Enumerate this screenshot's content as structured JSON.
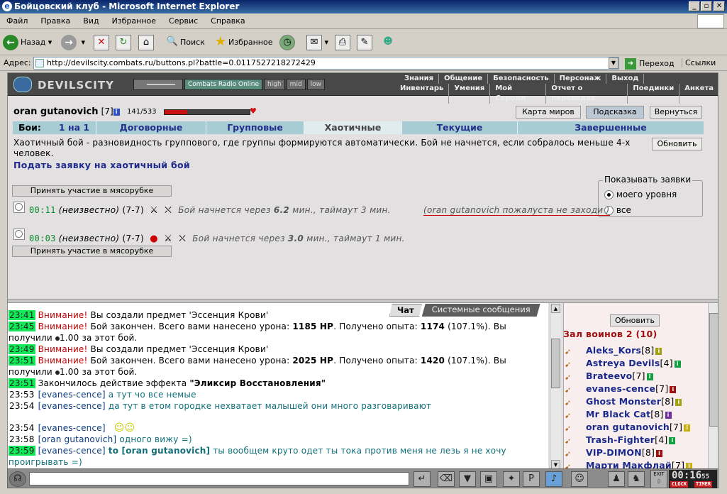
{
  "window": {
    "title": "Бойцовский клуб - Microsoft Internet Explorer"
  },
  "menu": [
    "Файл",
    "Правка",
    "Вид",
    "Избранное",
    "Сервис",
    "Справка"
  ],
  "toolbar": {
    "back": "Назад",
    "search": "Поиск",
    "favorites": "Избранное"
  },
  "address": {
    "label": "Адрес:",
    "url": "http://devilscity.combats.ru/buttons.pl?battle=0.0117527218272429",
    "go": "Переход",
    "links": "Ссылки"
  },
  "game": {
    "logo": "DEVILSCITY",
    "radio": {
      "name": "Combats Radio Online",
      "high": "high",
      "mid": "mid",
      "low": "low"
    },
    "nav_top": [
      "Знания",
      "Общение",
      "Безопасность",
      "Персонаж",
      "Выход"
    ],
    "nav_bottom": [
      "Инвентарь",
      "Умения",
      "Мой Скролл",
      "Отчет о переводах",
      "Поединки",
      "Анкета"
    ]
  },
  "user": {
    "name": "oran gutanovich",
    "level": "[7]",
    "hp": "141/533",
    "hp_fraction": 0.27
  },
  "top_buttons": {
    "map": "Карта миров",
    "hint": "Подсказка",
    "back": "Вернуться"
  },
  "fight_tabs": {
    "label": "Бои:",
    "items": [
      "1 на 1",
      "Договорные",
      "Групповые",
      "Хаотичные",
      "Текущие",
      "Завершенные"
    ]
  },
  "description": "Хаотичный бой - разновидность группового, где группы формируются автоматически. Бой не начнется, если собралось меньше 4-х человек.",
  "refresh": "Обновить",
  "apply_link": "Подать заявку на хаотичный бой",
  "filter": {
    "legend": "Показывать заявки",
    "opt1": "моего уровня",
    "opt2": "все"
  },
  "join_label": "Принять участие в мясорубке",
  "battles": [
    {
      "time": "00:11",
      "who": "(неизвестно)",
      "range": "(7-7)",
      "text_a": "Бой начнется через",
      "mins": "6.2",
      "text_b": "мин., таймаут 3 мин.",
      "comment": "(oran gutanovich пожалуста не заходи )"
    },
    {
      "time": "00:03",
      "who": "(неизвестно)",
      "range": "(7-7)",
      "text_a": "Бой начнется через",
      "mins": "3.0",
      "text_b": "мин., таймаут 1 мин."
    }
  ],
  "chat": {
    "tabs": [
      "Чат",
      "Системные сообщения"
    ],
    "lines": [
      {
        "t": "23:41",
        "w": "Внимание!",
        "m": "Вы создали предмет 'Эссенция Крови'"
      },
      {
        "t": "23:45",
        "w": "Внимание!",
        "m1": "Бой закончен. Всего вами нанесено урона:",
        "b1": "1185 HP",
        "m2": ". Получено опыта:",
        "b2": "1174",
        "m3": "(107.1%). Вы получили",
        "m4": "1.00 за этот бой."
      },
      {
        "t": "23:49",
        "w": "Внимание!",
        "m": "Вы создали предмет 'Эссенция Крови'"
      },
      {
        "t": "23:51",
        "w": "Внимание!",
        "m1": "Бой закончен. Всего вами нанесено урона:",
        "b1": "2025 HP",
        "m2": ". Получено опыта:",
        "b2": "1420",
        "m3": "(107.1%). Вы получили",
        "m4": "1.00 за этот бой."
      },
      {
        "t": "23:51",
        "w": "Закончилось действие эффекта",
        "b": "\"Эликсир Восстановления\""
      },
      {
        "t": "23:53",
        "n": "[evanes-cence]",
        "m": "а тут чо все немые"
      },
      {
        "t": "23:54",
        "n": "[evanes-cence]",
        "m": "да тут в етом городке нехватает малышей они много разговаривают"
      },
      {
        "t": "23:54",
        "n": "[evanes-cence]"
      },
      {
        "t": "23:58",
        "n": "[oran gutanovich]",
        "m": "одного вижу =)"
      },
      {
        "t": "23:59",
        "n": "[evanes-cence]",
        "to": "to [oran gutanovich]",
        "m": "ты вообщем круто одет ты тока против меня не лезь я не хочу проигрывать =)"
      }
    ]
  },
  "room": {
    "refresh": "Обновить",
    "name": "Зал воинов 2 (10)",
    "users": [
      {
        "name": "Aleks_Kors",
        "lvl": "[8]",
        "color": "#a0a010"
      },
      {
        "name": "Astreya Devils",
        "lvl": "[4]",
        "color": "#10a040"
      },
      {
        "name": "Brateevo",
        "lvl": "[7]",
        "color": "#10a040"
      },
      {
        "name": "evanes-cence",
        "lvl": "[7]",
        "color": "#a01010"
      },
      {
        "name": "Ghost Monster",
        "lvl": "[8]",
        "color": "#a0a010"
      },
      {
        "name": "Mr Black Cat",
        "lvl": "[8]",
        "color": "#7030a0"
      },
      {
        "name": "oran gutanovich",
        "lvl": "[7]",
        "color": "#c8b010"
      },
      {
        "name": "Trash-Fighter",
        "lvl": "[4]",
        "color": "#10a040"
      },
      {
        "name": "VIP-DIMON",
        "lvl": "[8]",
        "color": "#a01010"
      },
      {
        "name": "Марти Макфлай",
        "lvl": "[7]",
        "color": "#c8b010"
      }
    ]
  },
  "clock": {
    "time": "00:16",
    "ss": "55",
    "clock_label": "CLOCK",
    "timer_label": "TIMER",
    "exit": "EXIT"
  }
}
